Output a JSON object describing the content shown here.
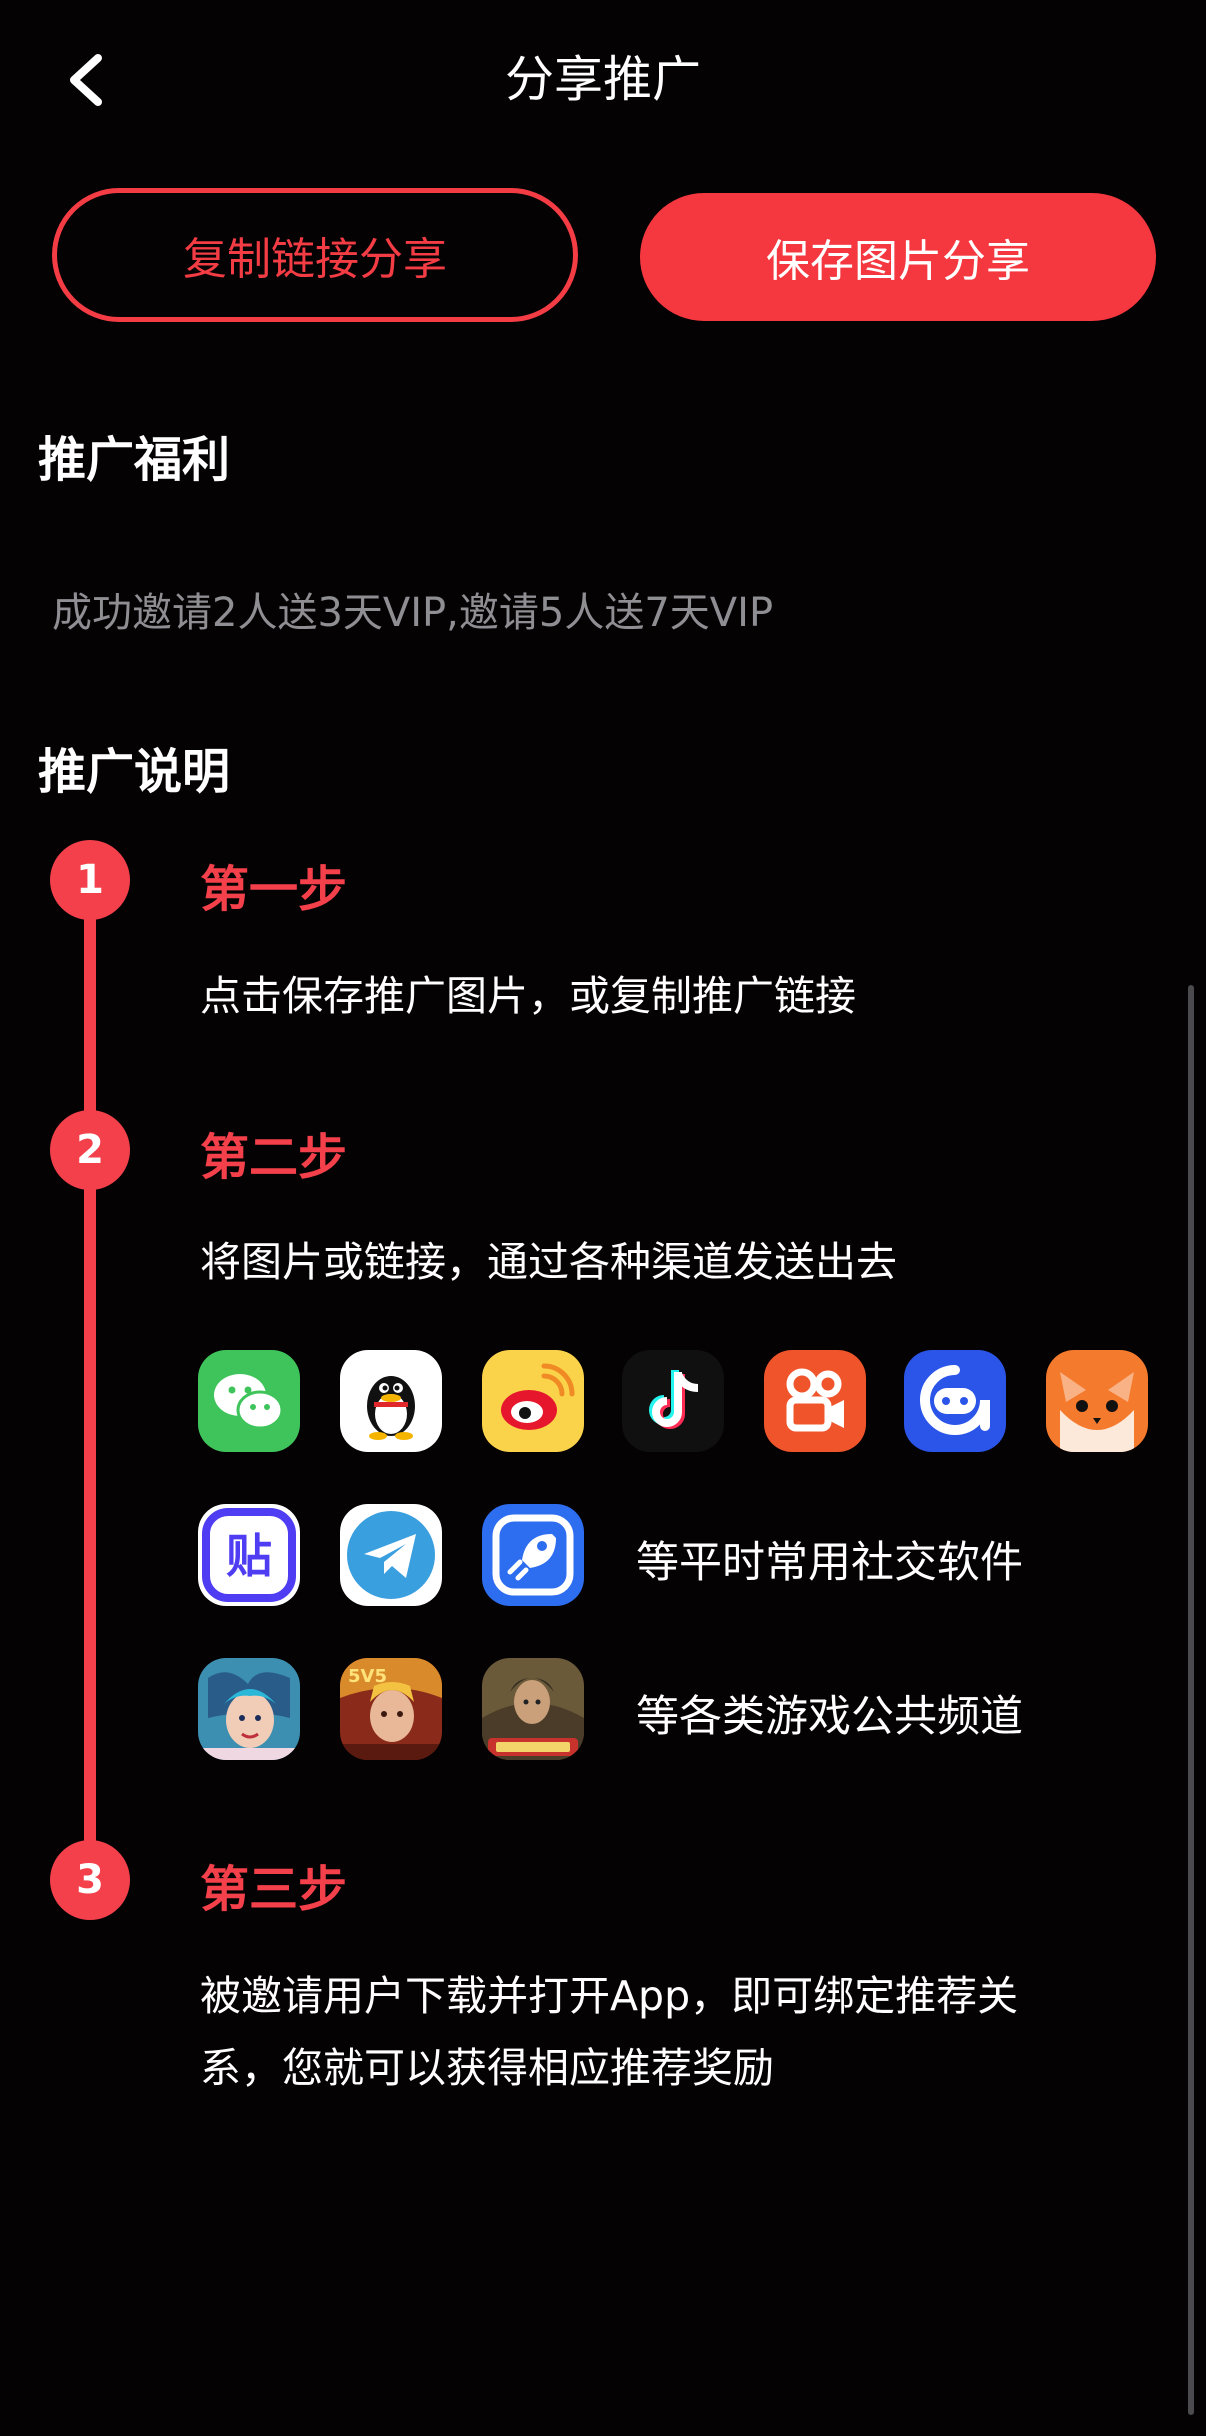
{
  "header": {
    "title": "分享推广"
  },
  "actions": {
    "copy_link": "复制链接分享",
    "save_image": "保存图片分享"
  },
  "benefits": {
    "title": "推广福利",
    "text": "成功邀请2人送3天VIP,邀请5人送7天VIP"
  },
  "instructions": {
    "title": "推广说明",
    "steps": [
      {
        "number": "1",
        "title": "第一步",
        "desc": "点击保存推广图片，或复制推广链接"
      },
      {
        "number": "2",
        "title": "第二步",
        "desc": "将图片或链接，通过各种渠道发送出去"
      },
      {
        "number": "3",
        "title": "第三步",
        "desc_line1": "被邀请用户下载并打开App，即可绑定推荐关",
        "desc_line2": "系，您就可以获得相应推荐奖励"
      }
    ]
  },
  "channels": {
    "row1_icons": [
      "wechat-icon",
      "qq-icon",
      "weibo-icon",
      "douyin-icon",
      "kuaishou-icon",
      "soul-icon",
      "fox-app-icon"
    ],
    "row2_icons": [
      "tieba-icon",
      "telegram-icon",
      "rocket-app-icon"
    ],
    "row2_label": "等平时常用社交软件",
    "row3_icons": [
      "game-icon-1",
      "honor-of-kings-icon",
      "pubg-icon"
    ],
    "row3_label": "等各类游戏公共频道"
  },
  "colors": {
    "accent": "#f3404a",
    "background": "#050203",
    "muted_text": "#8e8e93"
  }
}
